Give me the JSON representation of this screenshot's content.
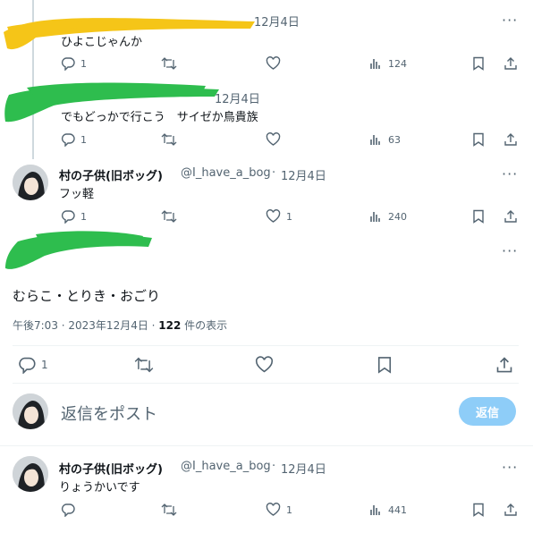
{
  "tweets": [
    {
      "date": "12月4日",
      "text": "ひよこじゃんか",
      "replies": "1",
      "views": "124",
      "likes": ""
    },
    {
      "date": "12月4日",
      "text": "でもどっかで行こう　サイゼか鳥貴族",
      "replies": "1",
      "views": "63",
      "likes": ""
    },
    {
      "name": "村の子供(旧ボッグ)",
      "handle": "@I_have_a_bog",
      "sep": "·",
      "date": "12月4日",
      "text": "フッ軽",
      "replies": "1",
      "likes": "1",
      "views": "240"
    }
  ],
  "main": {
    "text": "むらこ・とりき・おごり",
    "timestamp": "午後7:03 · 2023年12月4日 · ",
    "views_count": "122",
    "views_label": " 件の表示",
    "replies": "1"
  },
  "composer": {
    "placeholder": "返信をポスト",
    "button": "返信"
  },
  "reply": {
    "name": "村の子供(旧ボッグ)",
    "handle": "@I_have_a_bog",
    "sep": "·",
    "date": "12月4日",
    "text": "りょうかいです",
    "replies": "",
    "likes": "1",
    "views": "441"
  },
  "colors": {
    "redaction_yellow": "#f5c518",
    "redaction_green": "#2ebd4e",
    "reply_button": "#8ecdf8"
  }
}
